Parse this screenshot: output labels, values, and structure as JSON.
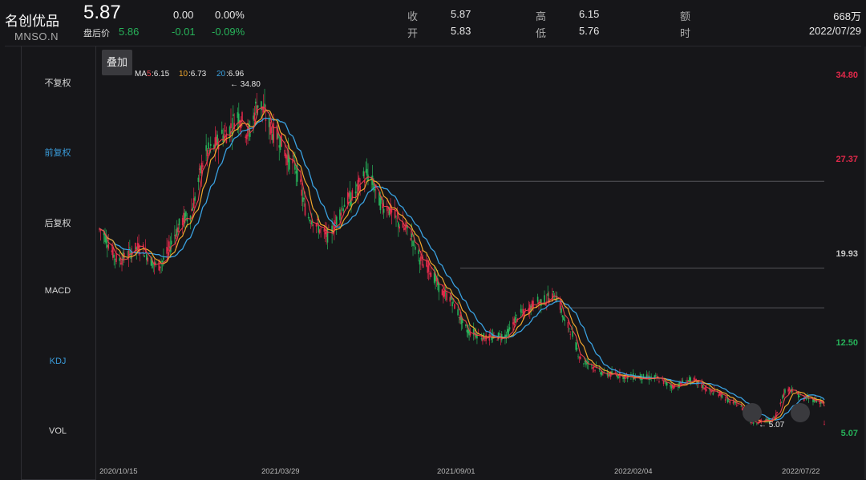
{
  "header": {
    "name": "名创优品",
    "ticker": "MNSO.N",
    "price": "5.87",
    "change": "0.00",
    "change_pct": "0.00%",
    "after_hours_label": "盘后价",
    "after_hours_price": "5.86",
    "after_hours_change": "-0.01",
    "after_hours_change_pct": "-0.09%",
    "close_label": "收",
    "close_value": "5.87",
    "open_label": "开",
    "open_value": "5.83",
    "high_label": "高",
    "high_value": "6.15",
    "low_label": "低",
    "low_value": "5.76",
    "amount_label": "额",
    "amount_value": "668万",
    "time_label": "时",
    "time_value": "2022/07/29"
  },
  "sidebar": {
    "items": [
      {
        "label": "不复权",
        "active": false
      },
      {
        "label": "前复权",
        "active": true
      },
      {
        "label": "后复权",
        "active": false
      },
      {
        "label": "MACD",
        "active": false
      },
      {
        "label": "KDJ",
        "active": true
      },
      {
        "label": "VOL",
        "active": false
      }
    ]
  },
  "toolbar": {
    "overlay_label": "叠加"
  },
  "ma_legend": {
    "ma_prefix": "MA",
    "ma5_key": "5",
    "ma5_value": ":6.15",
    "ma10_key": "10",
    "ma10_value": ":6.73",
    "ma20_key": "20",
    "ma20_value": ":6.96"
  },
  "colors": {
    "up": "#e0294a",
    "down": "#27b35a",
    "ma5": "#e8404a",
    "ma10": "#f0a72e",
    "ma20": "#3aa1e0"
  },
  "chart_data": {
    "type": "candlestick",
    "y_axis_labels": [
      "34.80",
      "27.37",
      "19.93",
      "12.50",
      "5.07"
    ],
    "ylim": [
      5.07,
      34.8
    ],
    "x_labels": [
      "2020/10/15",
      "2021/03/29",
      "2021/09/01",
      "2022/02/04",
      "2022/07/22"
    ],
    "max_marker": "34.80",
    "min_marker": "5.07",
    "reference_levels": [
      26.0,
      18.8,
      15.5
    ],
    "price_anchors": [
      [
        "2020/10/15",
        22.0
      ],
      [
        "2020/11/01",
        19.5
      ],
      [
        "2020/11/20",
        20.5
      ],
      [
        "2020/12/05",
        19.0
      ],
      [
        "2021/01/01",
        23.0
      ],
      [
        "2021/01/20",
        28.5
      ],
      [
        "2021/02/05",
        30.0
      ],
      [
        "2021/02/15",
        31.5
      ],
      [
        "2021/02/25",
        30.0
      ],
      [
        "2021/03/05",
        32.5
      ],
      [
        "2021/03/20",
        30.0
      ],
      [
        "2021/04/05",
        27.5
      ],
      [
        "2021/04/20",
        23.0
      ],
      [
        "2021/05/05",
        21.5
      ],
      [
        "2021/05/25",
        24.5
      ],
      [
        "2021/06/10",
        26.5
      ],
      [
        "2021/06/25",
        24.0
      ],
      [
        "2021/07/15",
        22.0
      ],
      [
        "2021/08/01",
        19.0
      ],
      [
        "2021/08/20",
        16.5
      ],
      [
        "2021/09/10",
        13.5
      ],
      [
        "2021/09/25",
        13.0
      ],
      [
        "2021/10/10",
        13.2
      ],
      [
        "2021/10/25",
        15.0
      ],
      [
        "2021/11/10",
        16.0
      ],
      [
        "2021/11/25",
        16.5
      ],
      [
        "2021/12/05",
        14.0
      ],
      [
        "2021/12/20",
        11.0
      ],
      [
        "2022/01/10",
        10.0
      ],
      [
        "2022/02/01",
        9.8
      ],
      [
        "2022/02/20",
        9.7
      ],
      [
        "2022/03/10",
        9.0
      ],
      [
        "2022/03/25",
        9.5
      ],
      [
        "2022/04/15",
        8.5
      ],
      [
        "2022/05/05",
        7.5
      ],
      [
        "2022/05/20",
        6.0
      ],
      [
        "2022/06/05",
        6.2
      ],
      [
        "2022/06/20",
        8.8
      ],
      [
        "2022/07/05",
        8.0
      ],
      [
        "2022/07/29",
        7.5
      ]
    ]
  }
}
